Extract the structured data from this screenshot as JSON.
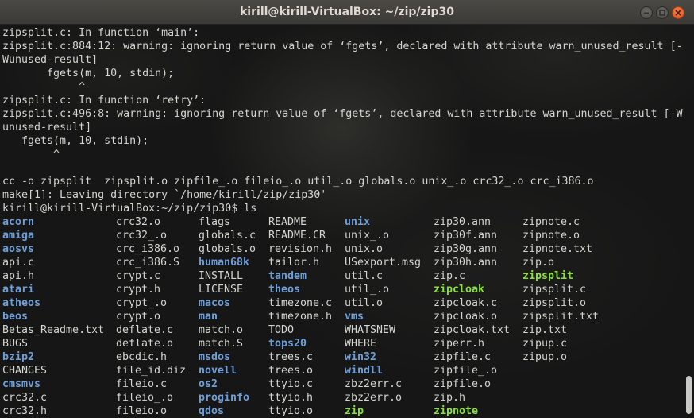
{
  "window": {
    "title": "kirill@kirill-VirtualBox: ~/zip/zip30"
  },
  "terminal": {
    "output_lines": [
      "zipsplit.c: In function ‘main’:",
      "zipsplit.c:884:12: warning: ignoring return value of ‘fgets’, declared with attribute warn_unused_result [-",
      "Wunused-result]",
      "       fgets(m, 10, stdin);",
      "            ^",
      "zipsplit.c: In function ‘retry’:",
      "zipsplit.c:496:8: warning: ignoring return value of ‘fgets’, declared with attribute warn_unused_result [-W",
      "unused-result]",
      "   fgets(m, 10, stdin);",
      "        ^",
      "",
      "cc -o zipsplit  zipsplit.o zipfile_.o fileio_.o util_.o globals.o unix_.o crc32_.o crc_i386.o",
      "make[1]: Leaving directory `/home/kirill/zip/zip30'",
      "kirill@kirill-VirtualBox:~/zip/zip30$ ls"
    ],
    "ls_rows": [
      [
        [
          "acorn",
          "dir"
        ],
        [
          "crc32.o",
          "file"
        ],
        [
          "flags",
          "file"
        ],
        [
          "README",
          "file"
        ],
        [
          "unix",
          "dir"
        ],
        [
          "zip30.ann",
          "file"
        ],
        [
          "zipnote.c",
          "file"
        ]
      ],
      [
        [
          "amiga",
          "dir"
        ],
        [
          "crc32_.o",
          "file"
        ],
        [
          "globals.c",
          "file"
        ],
        [
          "README.CR",
          "file"
        ],
        [
          "unix_.o",
          "file"
        ],
        [
          "zip30f.ann",
          "file"
        ],
        [
          "zipnote.o",
          "file"
        ]
      ],
      [
        [
          "aosvs",
          "dir"
        ],
        [
          "crc_i386.o",
          "file"
        ],
        [
          "globals.o",
          "file"
        ],
        [
          "revision.h",
          "file"
        ],
        [
          "unix.o",
          "file"
        ],
        [
          "zip30g.ann",
          "file"
        ],
        [
          "zipnote.txt",
          "file"
        ]
      ],
      [
        [
          "api.c",
          "file"
        ],
        [
          "crc_i386.S",
          "file"
        ],
        [
          "human68k",
          "dir"
        ],
        [
          "tailor.h",
          "file"
        ],
        [
          "USexport.msg",
          "file"
        ],
        [
          "zip30h.ann",
          "file"
        ],
        [
          "zip.o",
          "file"
        ]
      ],
      [
        [
          "api.h",
          "file"
        ],
        [
          "crypt.c",
          "file"
        ],
        [
          "INSTALL",
          "file"
        ],
        [
          "tandem",
          "dir"
        ],
        [
          "util.c",
          "file"
        ],
        [
          "zip.c",
          "file"
        ],
        [
          "zipsplit",
          "exe"
        ]
      ],
      [
        [
          "atari",
          "dir"
        ],
        [
          "crypt.h",
          "file"
        ],
        [
          "LICENSE",
          "file"
        ],
        [
          "theos",
          "dir"
        ],
        [
          "util_.o",
          "file"
        ],
        [
          "zipcloak",
          "exe"
        ],
        [
          "zipsplit.c",
          "file"
        ]
      ],
      [
        [
          "atheos",
          "dir"
        ],
        [
          "crypt_.o",
          "file"
        ],
        [
          "macos",
          "dir"
        ],
        [
          "timezone.c",
          "file"
        ],
        [
          "util.o",
          "file"
        ],
        [
          "zipcloak.c",
          "file"
        ],
        [
          "zipsplit.o",
          "file"
        ]
      ],
      [
        [
          "beos",
          "dir"
        ],
        [
          "crypt.o",
          "file"
        ],
        [
          "man",
          "dir"
        ],
        [
          "timezone.h",
          "file"
        ],
        [
          "vms",
          "dir"
        ],
        [
          "zipcloak.o",
          "file"
        ],
        [
          "zipsplit.txt",
          "file"
        ]
      ],
      [
        [
          "Betas_Readme.txt",
          "file"
        ],
        [
          "deflate.c",
          "file"
        ],
        [
          "match.o",
          "file"
        ],
        [
          "TODO",
          "file"
        ],
        [
          "WHATSNEW",
          "file"
        ],
        [
          "zipcloak.txt",
          "file"
        ],
        [
          "zip.txt",
          "file"
        ]
      ],
      [
        [
          "BUGS",
          "file"
        ],
        [
          "deflate.o",
          "file"
        ],
        [
          "match.S",
          "file"
        ],
        [
          "tops20",
          "dir"
        ],
        [
          "WHERE",
          "file"
        ],
        [
          "ziperr.h",
          "file"
        ],
        [
          "zipup.c",
          "file"
        ]
      ],
      [
        [
          "bzip2",
          "dir"
        ],
        [
          "ebcdic.h",
          "file"
        ],
        [
          "msdos",
          "dir"
        ],
        [
          "trees.c",
          "file"
        ],
        [
          "win32",
          "dir"
        ],
        [
          "zipfile.c",
          "file"
        ],
        [
          "zipup.o",
          "file"
        ]
      ],
      [
        [
          "CHANGES",
          "file"
        ],
        [
          "file_id.diz",
          "file"
        ],
        [
          "novell",
          "dir"
        ],
        [
          "trees.o",
          "file"
        ],
        [
          "windll",
          "dir"
        ],
        [
          "zipfile_.o",
          "file"
        ],
        [
          "",
          ""
        ]
      ],
      [
        [
          "cmsmvs",
          "dir"
        ],
        [
          "fileio.c",
          "file"
        ],
        [
          "os2",
          "dir"
        ],
        [
          "ttyio.c",
          "file"
        ],
        [
          "zbz2err.c",
          "file"
        ],
        [
          "zipfile.o",
          "file"
        ],
        [
          "",
          ""
        ]
      ],
      [
        [
          "crc32.c",
          "file"
        ],
        [
          "fileio_.o",
          "file"
        ],
        [
          "proginfo",
          "dir"
        ],
        [
          "ttyio.h",
          "file"
        ],
        [
          "zbz2err.o",
          "file"
        ],
        [
          "zip.h",
          "file"
        ],
        [
          "",
          ""
        ]
      ],
      [
        [
          "crc32.h",
          "file"
        ],
        [
          "fileio.o",
          "file"
        ],
        [
          "qdos",
          "dir"
        ],
        [
          "ttyio.o",
          "file"
        ],
        [
          "zip",
          "exe"
        ],
        [
          "zipnote",
          "exe"
        ],
        [
          "",
          ""
        ]
      ]
    ],
    "prompt": "kirill@kirill-VirtualBox:~/zip/zip30$ ",
    "colors": {
      "foreground": "#d3d7cf",
      "directory": "#6f9fd8",
      "executable": "#8ae234",
      "background": "#161616"
    }
  },
  "icons": {
    "close": "close-icon",
    "maximize": "maximize-icon",
    "minimize": "minimize-icon"
  }
}
